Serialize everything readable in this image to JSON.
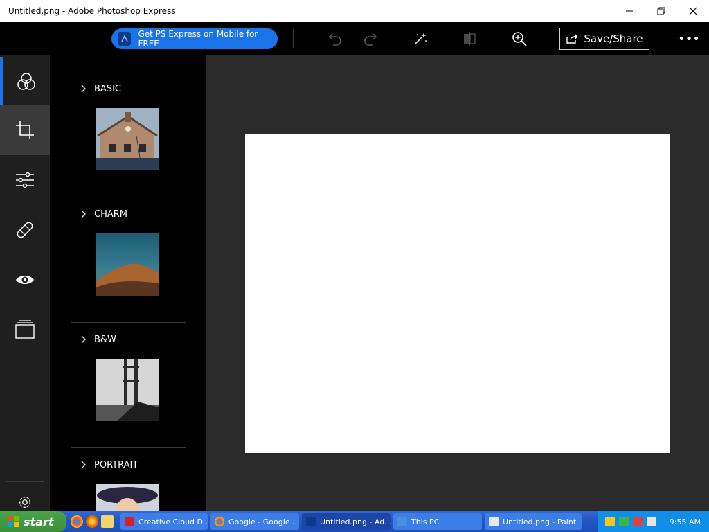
{
  "window": {
    "title": "Untitled.png - Adobe Photoshop Express",
    "controls": [
      "minimize-icon",
      "restore-icon",
      "close-icon"
    ]
  },
  "toolbar": {
    "promo_label": "Get PS Express on Mobile for FREE",
    "save_label": "Save/Share",
    "more_label": "•••",
    "icons": [
      "undo-icon",
      "redo-icon",
      "auto-fix-icon",
      "compare-icon",
      "zoom-icon",
      "share-icon"
    ]
  },
  "rail": {
    "items": [
      "looks-icon",
      "crop-icon",
      "adjustments-icon",
      "healing-icon",
      "red-eye-icon",
      "borders-icon",
      "settings-icon"
    ]
  },
  "filters": {
    "sections": [
      {
        "label": "BASIC"
      },
      {
        "label": "CHARM"
      },
      {
        "label": "B&W"
      },
      {
        "label": "PORTRAIT"
      }
    ]
  },
  "taskbar": {
    "start_label": "start",
    "tasks": [
      {
        "label": "Creative Cloud D..."
      },
      {
        "label": "Google - Google..."
      },
      {
        "label": "Untitled.png - Ad..."
      },
      {
        "label": "This PC"
      },
      {
        "label": "Untitled.png - Paint"
      }
    ],
    "clock": "9:55 AM"
  },
  "colors": {
    "accent": "#1a73e8",
    "toolbar_bg": "#000000",
    "workspace_bg": "#2b2b2b",
    "canvas": "#ffffff"
  }
}
